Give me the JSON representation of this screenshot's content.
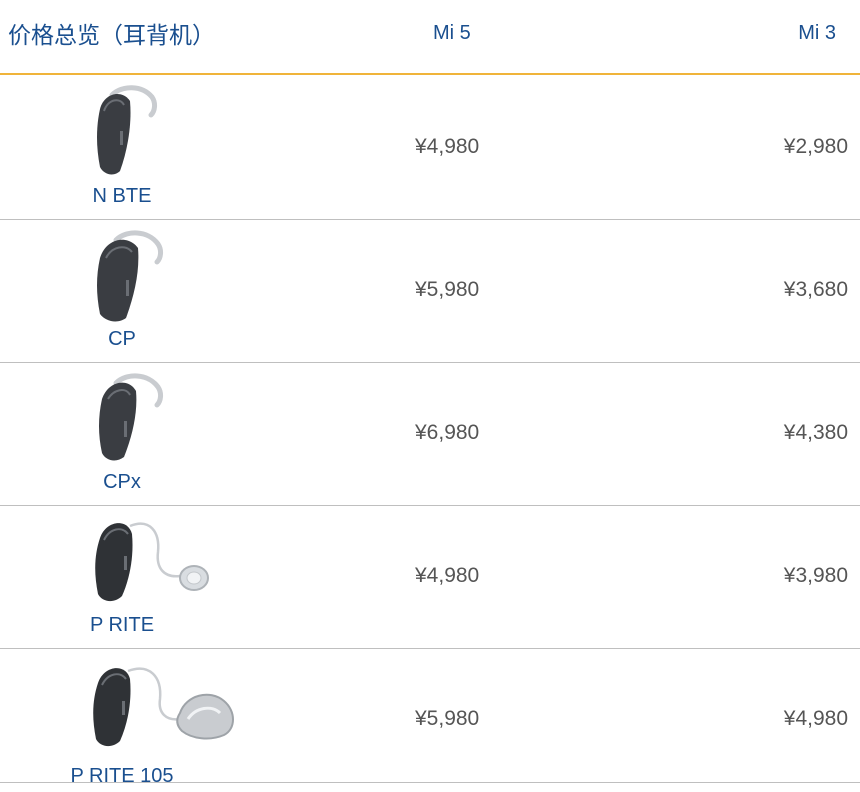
{
  "header": {
    "title": "价格总览（耳背机）",
    "columns": [
      "Mi 5",
      "Mi 3"
    ]
  },
  "rows": [
    {
      "model": "N BTE",
      "image": "bte-hearing-aid-icon",
      "mi5": "¥4,980",
      "mi3": "¥2,980"
    },
    {
      "model": "CP",
      "image": "bte-hearing-aid-icon",
      "mi5": "¥5,980",
      "mi3": "¥3,680"
    },
    {
      "model": "CPx",
      "image": "bte-hearing-aid-icon",
      "mi5": "¥6,980",
      "mi3": "¥4,380"
    },
    {
      "model": "P RITE",
      "image": "rite-hearing-aid-icon",
      "mi5": "¥4,980",
      "mi3": "¥3,980"
    },
    {
      "model": "P RITE 105",
      "image": "rite-hearing-aid-icon",
      "mi5": "¥5,980",
      "mi3": "¥4,980"
    }
  ],
  "colors": {
    "heading": "#1a4f8f",
    "accent_line": "#f0b43a",
    "price_text": "#555555",
    "divider": "#bfbfbf"
  }
}
